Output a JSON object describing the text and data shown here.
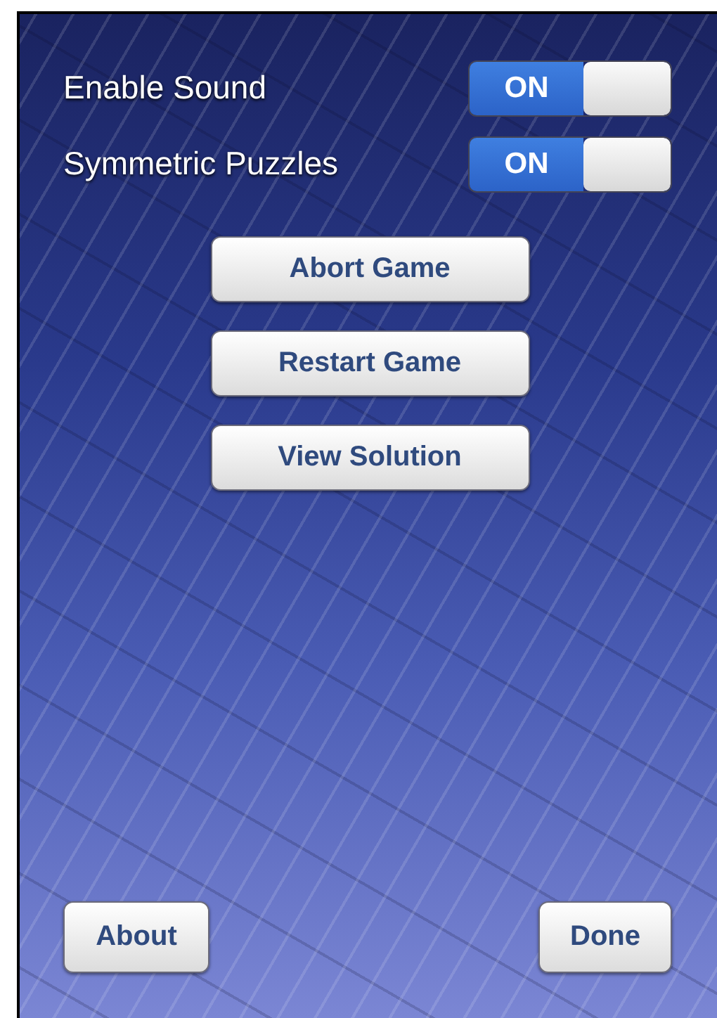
{
  "settings": [
    {
      "label": "Enable Sound",
      "switch_text": "ON",
      "on": true
    },
    {
      "label": "Symmetric Puzzles",
      "switch_text": "ON",
      "on": true
    }
  ],
  "actions": [
    "Abort Game",
    "Restart Game",
    "View Solution"
  ],
  "footer": {
    "left": "About",
    "right": "Done"
  }
}
